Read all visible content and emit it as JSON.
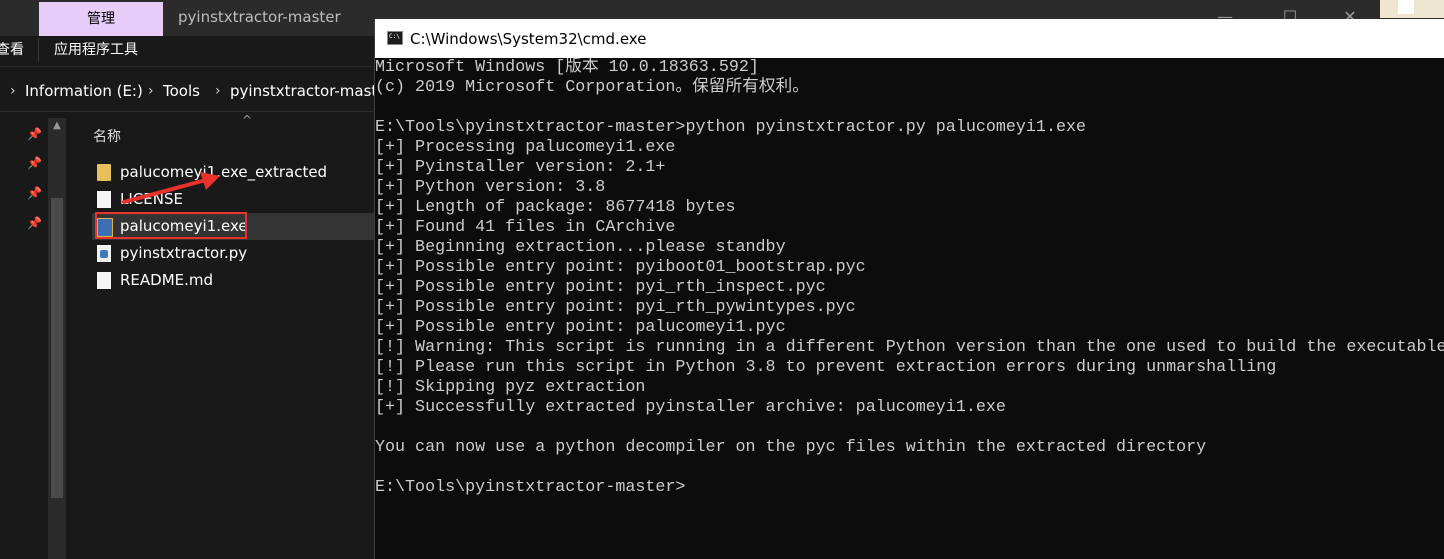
{
  "explorer": {
    "ribbon_manage_tab": "管理",
    "window_title": "pyinstxtractor-master",
    "ribbon_view_tab": "查看",
    "ribbon_app_tools": "应用程序工具",
    "breadcrumbs": [
      "Information (E:)",
      "Tools",
      "pyinstxtractor-master"
    ],
    "column_name_header": "名称",
    "files": [
      {
        "name": "palucomeyi1.exe_extracted",
        "icon": "folder-icon"
      },
      {
        "name": "LICENSE",
        "icon": "document-icon"
      },
      {
        "name": "palucomeyi1.exe",
        "icon": "exe-icon",
        "selected": true,
        "highlighted": true
      },
      {
        "name": "pyinstxtractor.py",
        "icon": "python-file-icon"
      },
      {
        "name": "README.md",
        "icon": "markdown-file-icon"
      }
    ],
    "highlight_color": "#e8322b"
  },
  "cmd": {
    "window_title": "C:\\Windows\\System32\\cmd.exe",
    "lines": [
      "Microsoft Windows [版本 10.0.18363.592]",
      "(c) 2019 Microsoft Corporation。保留所有权利。",
      "",
      "E:\\Tools\\pyinstxtractor-master>python pyinstxtractor.py palucomeyi1.exe",
      "[+] Processing palucomeyi1.exe",
      "[+] Pyinstaller version: 2.1+",
      "[+] Python version: 3.8",
      "[+] Length of package: 8677418 bytes",
      "[+] Found 41 files in CArchive",
      "[+] Beginning extraction...please standby",
      "[+] Possible entry point: pyiboot01_bootstrap.pyc",
      "[+] Possible entry point: pyi_rth_inspect.pyc",
      "[+] Possible entry point: pyi_rth_pywintypes.pyc",
      "[+] Possible entry point: palucomeyi1.pyc",
      "[!] Warning: This script is running in a different Python version than the one used to build the executable.",
      "[!] Please run this script in Python 3.8 to prevent extraction errors during unmarshalling",
      "[!] Skipping pyz extraction",
      "[+] Successfully extracted pyinstaller archive: palucomeyi1.exe",
      "",
      "You can now use a python decompiler on the pyc files within the extracted directory",
      "",
      "E:\\Tools\\pyinstxtractor-master>"
    ],
    "text_color": "#cccccc",
    "background_color": "#0c0c0c"
  }
}
